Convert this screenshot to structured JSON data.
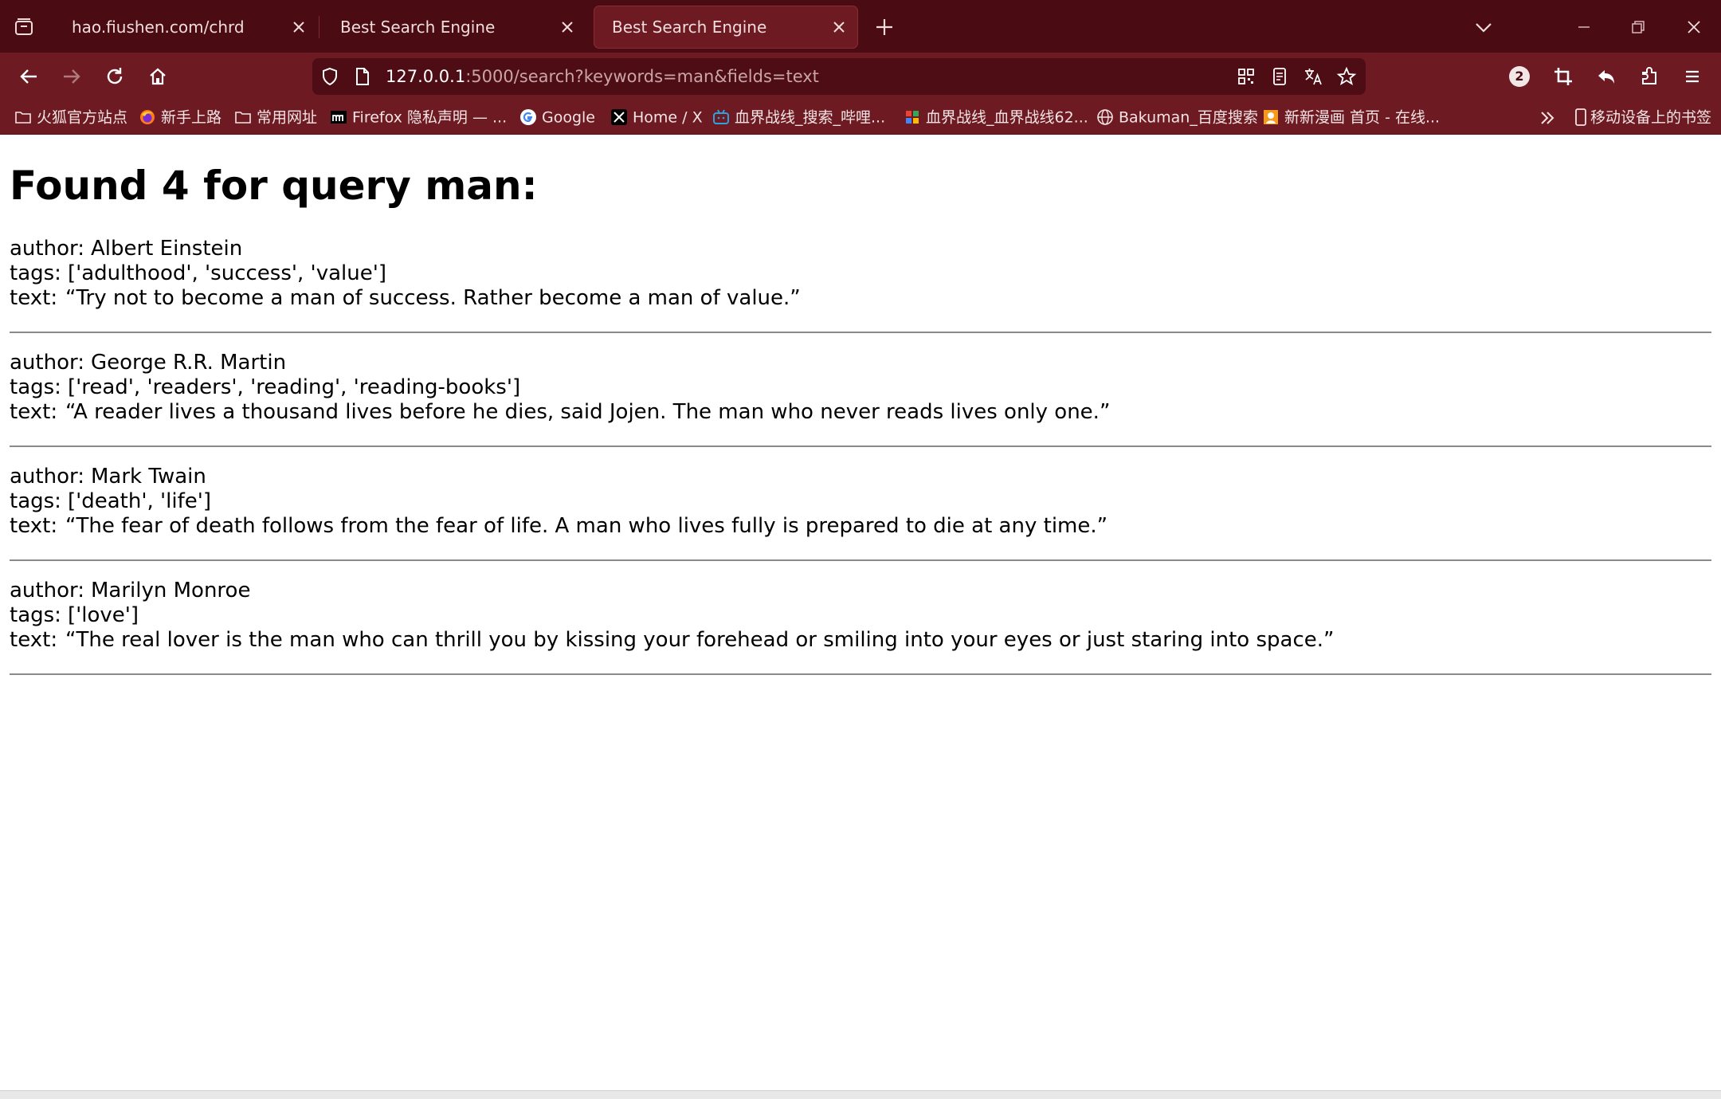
{
  "tabs": [
    {
      "title": "hao.fiushen.com/chrd",
      "active": false
    },
    {
      "title": "Best Search Engine",
      "active": false
    },
    {
      "title": "Best Search Engine",
      "active": true
    }
  ],
  "address_bar": {
    "host": "127.0.0.1",
    "rest": ":5000/search?keywords=man&fields=text"
  },
  "extensions_badge": "2",
  "bookmarks": [
    {
      "label": "火狐官方站点",
      "icon": "folder-icon"
    },
    {
      "label": "新手上路",
      "icon": "firefox-icon"
    },
    {
      "label": "常用网址",
      "icon": "folder-icon"
    },
    {
      "label": "Firefox 隐私声明 — ...",
      "icon": "mozilla-icon"
    },
    {
      "label": "Google",
      "icon": "google-icon"
    },
    {
      "label": "Home / X",
      "icon": "x-icon"
    },
    {
      "label": "血界战线_搜索_哔哩...",
      "icon": "bilibili-icon"
    },
    {
      "label": "血界战线_血界战线62...",
      "icon": "tiles-icon"
    },
    {
      "label": "Bakuman_百度搜索",
      "icon": "globe-icon"
    },
    {
      "label": "新新漫画 首页 - 在线...",
      "icon": "manga-icon"
    }
  ],
  "mobile_bookmarks": "移动设备上的书签",
  "page": {
    "title": "Found 4 for query man:",
    "labels": {
      "author": "author:",
      "tags": "tags:",
      "text": "text:"
    },
    "results": [
      {
        "author": "Albert Einstein",
        "tags": "['adulthood', 'success', 'value']",
        "text": "“Try not to become a man of success. Rather become a man of value.”"
      },
      {
        "author": "George R.R. Martin",
        "tags": "['read', 'readers', 'reading', 'reading-books']",
        "text": "“A reader lives a thousand lives before he dies, said Jojen. The man who never reads lives only one.”"
      },
      {
        "author": "Mark Twain",
        "tags": "['death', 'life']",
        "text": "“The fear of death follows from the fear of life. A man who lives fully is prepared to die at any time.”"
      },
      {
        "author": "Marilyn Monroe",
        "tags": "['love']",
        "text": "“The real lover is the man who can thrill you by kissing your forehead or smiling into your eyes or just staring into space.”"
      }
    ]
  },
  "colors": {
    "tabstrip": "#4a0b12",
    "toolbar": "#6d1a22",
    "urlbar": "#4e0d15"
  }
}
